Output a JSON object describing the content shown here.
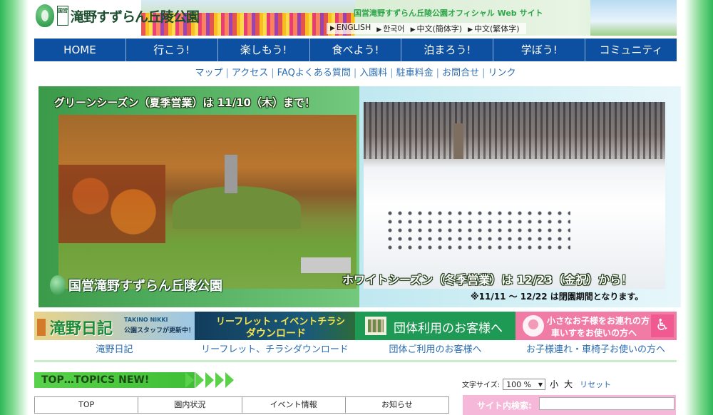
{
  "header": {
    "logo_badge": "国営",
    "logo_text": "滝野すずらん丘陵公園",
    "site_title": "国営滝野すずらん丘陵公園オフィシャル Web サイト",
    "languages": [
      "ENGLISH",
      "한국어",
      "中文(簡体字)",
      "中文(繁体字)"
    ]
  },
  "nav": [
    "HOME",
    "行こう!",
    "楽しもう!",
    "食べよう!",
    "泊まろう!",
    "学ぼう!",
    "コミュニティ"
  ],
  "subnav": [
    "マップ",
    "アクセス",
    "FAQよくある質問",
    "入園料",
    "駐車料金",
    "お問合せ",
    "リンク"
  ],
  "banner": {
    "green_caption": "グリーンシーズン（夏季営業）は 11/10（木）まで！",
    "white_caption": "ホワイトシーズン（冬季営業）は 12/23（金祝）から！",
    "note": "※11/11 ～ 12/22 は閉園期間となります。",
    "logo_badge": "国営",
    "logo_text": "滝野すずらん丘陵公園"
  },
  "promos": {
    "diary_title": "滝野日記",
    "diary_en": "TAKINO NIKKI",
    "diary_sub": "公園スタッフが更新中！",
    "leaflet_line1": "リーフレット・イベントチラシ",
    "leaflet_line2": "ダウンロード",
    "group_text": "団体利用のお客様へ",
    "kids_line1": "小さなお子様をお連れの方",
    "kids_line2": "車いすをお使いの方へ",
    "wheelchair_glyph": "♿"
  },
  "promo_captions": [
    "滝野日記",
    "リーフレット、チラシダウンロード",
    "団体ご利用のお客様へ",
    "お子様連れ・車椅子お使いの方へ"
  ],
  "topics": {
    "heading": "TOP…TOPICS NEW!",
    "tabs": [
      "TOP",
      "園内状況",
      "イベント情報",
      "お知らせ"
    ]
  },
  "font_size": {
    "label": "文字サイズ:",
    "value": "100 %",
    "options": [
      "小",
      "大"
    ],
    "reset": "リセット"
  },
  "search": {
    "label": "サイト内検索:"
  },
  "colors": {
    "nav_bg": "#0d4fa0",
    "link": "#2a6cb0",
    "accent_green": "#58d24a",
    "search_pink": "#f6b8d9"
  }
}
